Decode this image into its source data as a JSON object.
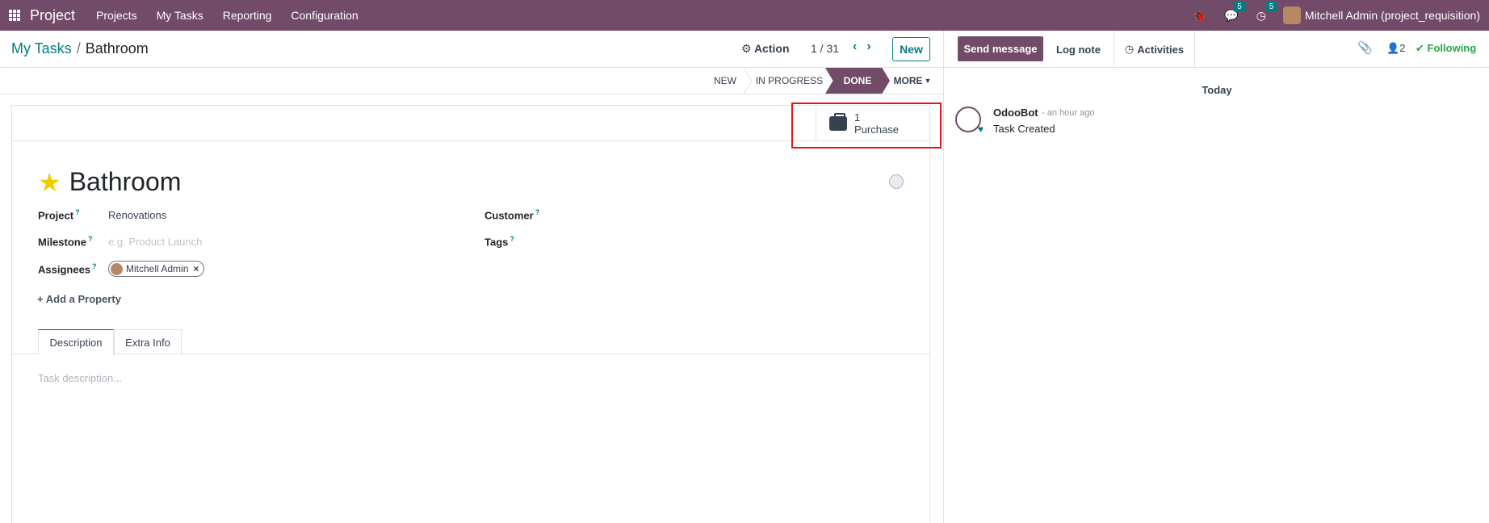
{
  "navbar": {
    "app_name": "Project",
    "menu": [
      "Projects",
      "My Tasks",
      "Reporting",
      "Configuration"
    ],
    "messages_count": "5",
    "activities_count": "5",
    "user": "Mitchell Admin (project_requisition)"
  },
  "control": {
    "breadcrumb_parent": "My Tasks",
    "breadcrumb_current": "Bathroom",
    "action_label": "Action",
    "pager": "1 / 31",
    "new_label": "New"
  },
  "statusbar": {
    "stages": [
      "NEW",
      "IN PROGRESS",
      "DONE"
    ],
    "active_stage": "DONE",
    "more_label": "MORE"
  },
  "smart_button": {
    "count": "1",
    "label": "Purchase"
  },
  "form": {
    "title": "Bathroom",
    "project_label": "Project",
    "project_value": "Renovations",
    "milestone_label": "Milestone",
    "milestone_placeholder": "e.g. Product Launch",
    "assignees_label": "Assignees",
    "assignee": "Mitchell Admin",
    "customer_label": "Customer",
    "tags_label": "Tags",
    "add_property": "Add a Property",
    "tab_description": "Description",
    "tab_extra": "Extra Info",
    "description_placeholder": "Task description..."
  },
  "chatter": {
    "send_message": "Send message",
    "log_note": "Log note",
    "activities": "Activities",
    "followers_count": "2",
    "following": "Following",
    "date_separator": "Today",
    "message_author": "OdooBot",
    "message_time": "- an hour ago",
    "message_body": "Task Created"
  },
  "colors": {
    "brand": "#714b67",
    "accent": "#017e84",
    "highlight": "#e0171b",
    "following": "#28a745"
  }
}
